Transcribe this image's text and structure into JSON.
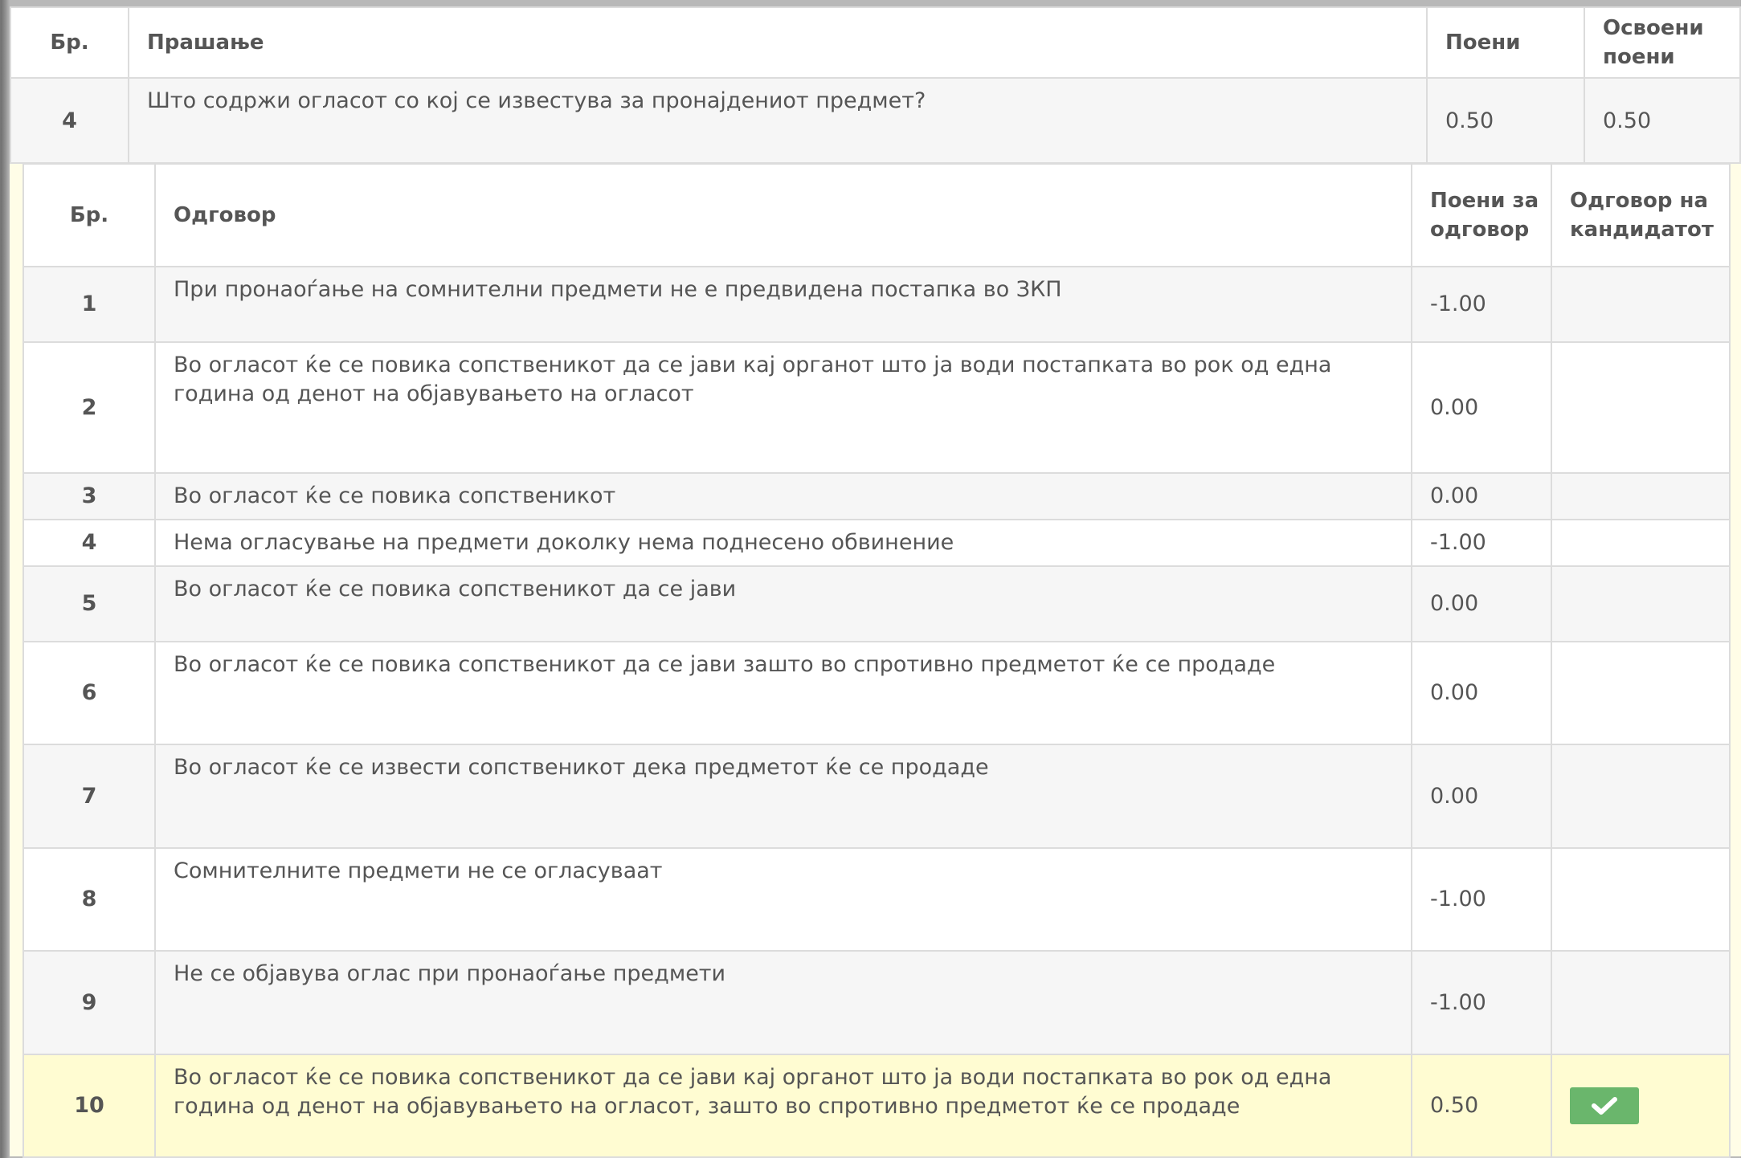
{
  "question_table": {
    "headers": {
      "num": "Бр.",
      "question": "Прашање",
      "points": "Поени",
      "earned": "Освоени поени"
    },
    "row": {
      "num": "4",
      "question": "Што содржи огласот со кој се известува за пронајдениот предмет?",
      "points": "0.50",
      "earned": "0.50"
    }
  },
  "answers_table": {
    "headers": {
      "num": "Бр.",
      "answer": "Одговор",
      "points": "Поени за одговор",
      "candidate": "Одговор на кандидатот"
    },
    "rows": [
      {
        "num": "1",
        "text": "При пронаоѓање на сомнителни предмети не е предвидена постапка во ЗКП",
        "points": "-1.00"
      },
      {
        "num": "2",
        "text": "Во огласот ќе се повика сопственикот да се јави кај органот што ја води постапката во рок од една година од денот на објавувањето на огласот",
        "points": "0.00"
      },
      {
        "num": "3",
        "text": "Во огласот ќе се повика сопственикот",
        "points": "0.00"
      },
      {
        "num": "4",
        "text": "Нема огласување на предмети доколку нема поднесено обвинение",
        "points": "-1.00"
      },
      {
        "num": "5",
        "text": "Во огласот ќе се повика сопственикот да се јави",
        "points": "0.00"
      },
      {
        "num": "6",
        "text": "Во огласот ќе се повика сопственикот да се јави зашто во спротивно предметот ќе се продаде",
        "points": "0.00"
      },
      {
        "num": "7",
        "text": "Во огласот ќе се извести сопственикот дека предметот ќе се продаде",
        "points": "0.00"
      },
      {
        "num": "8",
        "text": "Сомнителните предмети не се огласуваат",
        "points": "-1.00"
      },
      {
        "num": "9",
        "text": "Не се објавува оглас при пронаоѓање предмети",
        "points": "-1.00"
      },
      {
        "num": "10",
        "text": "Во огласот ќе се повика сопственикот да се јави кај органот што ја води постапката во рок од една година од денот на објавувањето на огласот, зашто во спротивно предметот ќе се продаде",
        "points": "0.50",
        "candidate_icon": "check-icon"
      }
    ]
  },
  "colors": {
    "selected_row": "#fffcd2",
    "check_button": "#6ab66c"
  }
}
